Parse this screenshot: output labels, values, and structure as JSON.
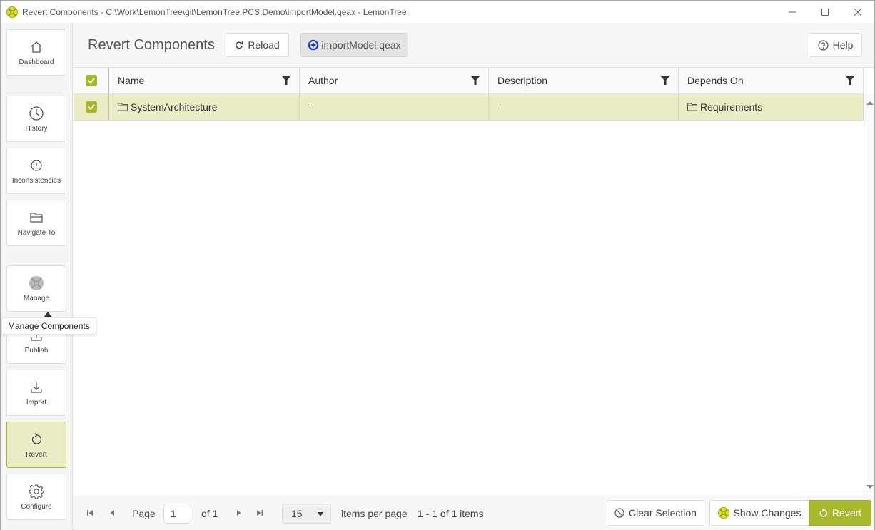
{
  "window": {
    "title": "Revert Components - C:\\Work\\LemonTree\\git\\LemonTree.PCS.Demo\\importModel.qeax - LemonTree",
    "controls": [
      "minimize",
      "maximize",
      "close"
    ]
  },
  "sidebar": {
    "items": [
      {
        "label": "Dashboard",
        "icon": "home-icon",
        "active": false
      },
      {
        "label": "History",
        "icon": "clock-icon",
        "active": false
      },
      {
        "label": "Inconsistencies",
        "icon": "exclamation-circle-icon",
        "active": false
      },
      {
        "label": "Navigate To",
        "icon": "folder-open-icon",
        "active": false
      },
      {
        "label": "Manage",
        "icon": "lemontree-logo-icon",
        "active": false
      },
      {
        "label": "Publish",
        "icon": "upload-icon",
        "active": false
      },
      {
        "label": "Import",
        "icon": "download-icon",
        "active": false
      },
      {
        "label": "Revert",
        "icon": "revert-icon",
        "active": true
      },
      {
        "label": "Configure",
        "icon": "gear-icon",
        "active": false
      }
    ],
    "tooltip": "Manage Components"
  },
  "toolbar": {
    "title": "Revert Components",
    "reload_label": "Reload",
    "file_label": "importModel.qeax",
    "help_label": "Help"
  },
  "grid": {
    "header_checked": true,
    "columns": [
      "Name",
      "Author",
      "Description",
      "Depends On"
    ],
    "rows": [
      {
        "checked": true,
        "name": "SystemArchitecture",
        "author": "-",
        "description": "-",
        "depends_on": "Requirements"
      }
    ]
  },
  "pager": {
    "page_label": "Page",
    "page_value": "1",
    "of_label": "of 1",
    "page_size": "15",
    "per_page_label": "items per page",
    "summary": "1 - 1 of 1 items"
  },
  "footer_actions": {
    "clear_label": "Clear Selection",
    "show_changes_label": "Show Changes",
    "revert_label": "Revert"
  },
  "colors": {
    "accent": "#a8b82c",
    "selected_row": "#eaedc5",
    "active_nav": "#e9ecc4"
  }
}
